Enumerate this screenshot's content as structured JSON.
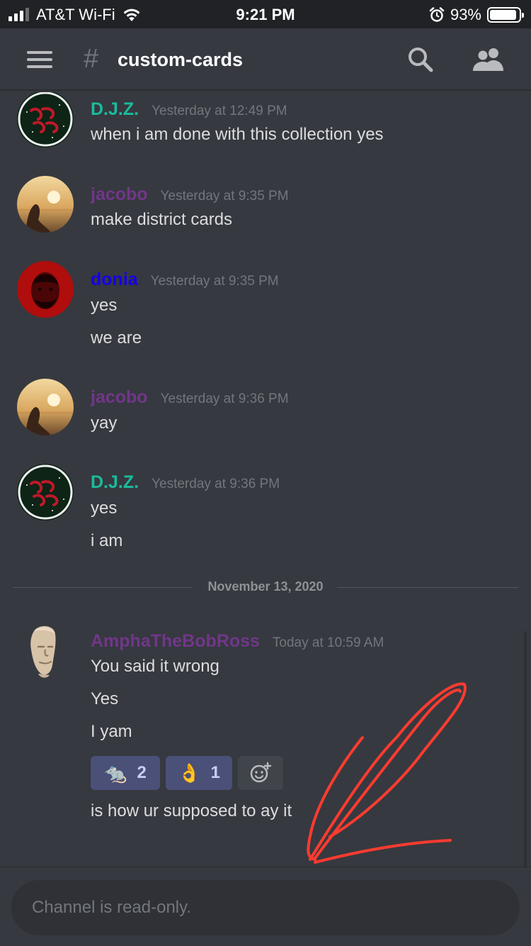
{
  "status_bar": {
    "carrier": "AT&T Wi-Fi",
    "time": "9:21 PM",
    "battery": "93%",
    "battery_level": 0.93
  },
  "header": {
    "hash": "#",
    "channel_name": "custom-cards"
  },
  "messages": [
    {
      "author": "D.J.Z.",
      "author_color": "#1abc9c",
      "timestamp": "Yesterday at 12:49 PM",
      "lines": [
        "when i am done with this collection yes"
      ]
    },
    {
      "author": "jacobo",
      "author_color": "#71368a",
      "timestamp": "Yesterday at 9:35 PM",
      "lines": [
        "make district cards"
      ]
    },
    {
      "author": "donia",
      "author_color": "#1500e5",
      "timestamp": "Yesterday at 9:35 PM",
      "lines": [
        "yes",
        "we are"
      ]
    },
    {
      "author": "jacobo",
      "author_color": "#71368a",
      "timestamp": "Yesterday at 9:36 PM",
      "lines": [
        "yay"
      ]
    },
    {
      "author": "D.J.Z.",
      "author_color": "#1abc9c",
      "timestamp": "Yesterday at 9:36 PM",
      "lines": [
        "yes",
        "i am"
      ]
    },
    {
      "author": "AmphaTheBobRoss",
      "author_color": "#71368a",
      "timestamp": "Today at 10:59 AM",
      "lines": [
        "You said it wrong",
        "Yes",
        "I yam",
        "is how ur supposed to ay it"
      ]
    }
  ],
  "date_divider": "November 13, 2020",
  "reactions": [
    {
      "emoji": "🐀",
      "icon": "rat-emoji",
      "count": "2"
    },
    {
      "emoji": "👌",
      "icon": "ok-hand-emoji",
      "count": "1"
    }
  ],
  "composer": {
    "placeholder": "Channel is read-only."
  },
  "colors": {
    "background": "#36393f",
    "status_bar": "#202225",
    "reaction_bg": "#4a5077",
    "annotation_red": "#ff3b30"
  }
}
